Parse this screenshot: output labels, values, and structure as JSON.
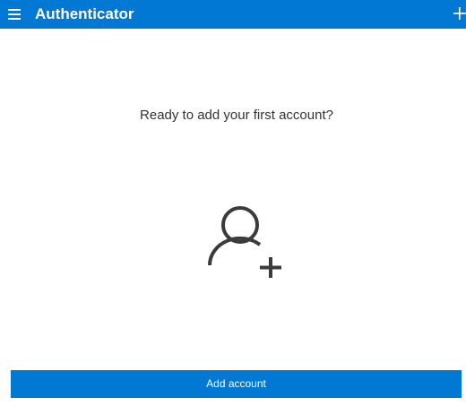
{
  "header": {
    "title": "Authenticator",
    "menu_icon": "hamburger-menu-icon",
    "add_icon": "plus-icon"
  },
  "main": {
    "prompt": "Ready to add your first account?",
    "illustration_icon": "add-person-icon"
  },
  "footer": {
    "add_account_label": "Add account"
  },
  "colors": {
    "accent": "#0078d4",
    "background": "#ffffff",
    "text": "#333333",
    "icon": "#3b3b3b"
  }
}
